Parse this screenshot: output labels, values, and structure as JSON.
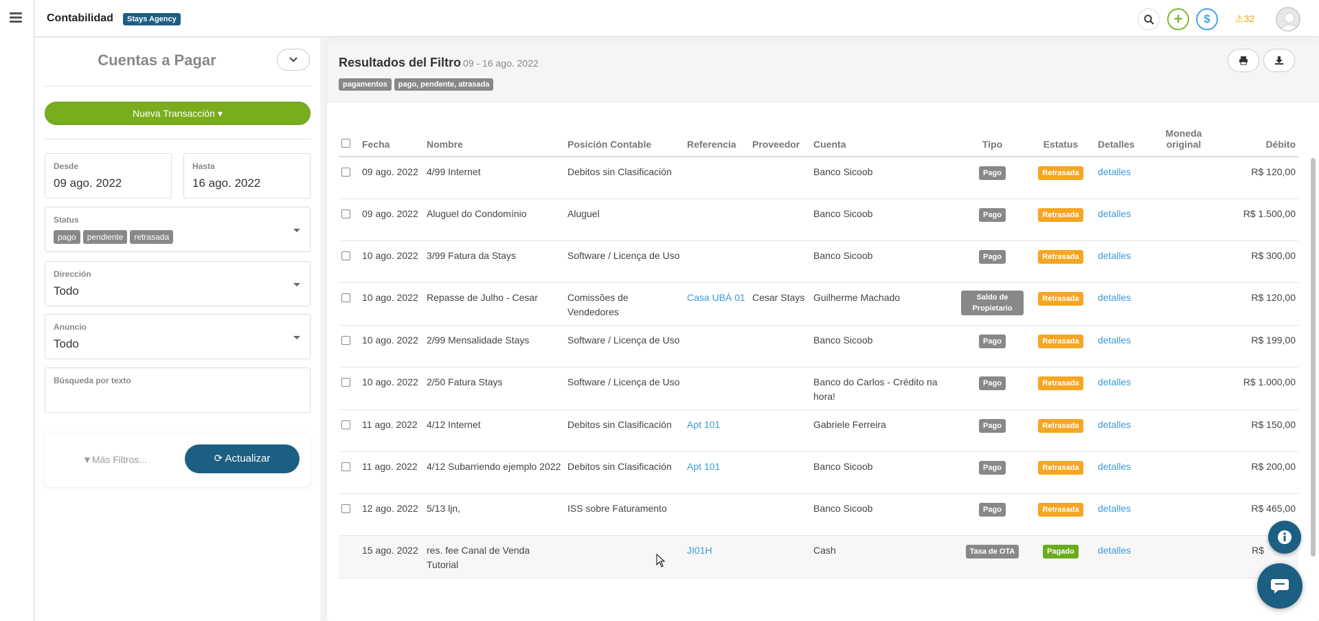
{
  "app": {
    "title": "Contabilidad",
    "agency": "Stays Agency",
    "alerts": "32"
  },
  "colors": {
    "primary": "#1c5f83",
    "green": "#7aad1e",
    "late": "#f5a623",
    "paid": "#6aac1e",
    "link": "#3a9ad9"
  },
  "left": {
    "title": "Cuentas a Pagar",
    "new_transaction": "Nueva Transacción",
    "desde_label": "Desde",
    "desde_value": "09 ago. 2022",
    "hasta_label": "Hasta",
    "hasta_value": "16 ago. 2022",
    "status_label": "Status",
    "status_tags": [
      "pago",
      "pendiente",
      "retrasada"
    ],
    "direccion_label": "Dirección",
    "direccion_value": "Todo",
    "anuncio_label": "Anuncio",
    "anuncio_value": "Todo",
    "search_label": "Búsqueda por texto",
    "more_filters": "Más Filtros...",
    "refresh": "Actualizar"
  },
  "main": {
    "title": "Resultados del Filtro",
    "range": "09 - 16 ago. 2022",
    "tags": [
      "pagamentos",
      "pago, pendente, atrasada"
    ],
    "columns": [
      "Fecha",
      "Nombre",
      "Posición Contable",
      "Referencia",
      "Proveedor",
      "Cuenta",
      "Tipo",
      "Estatus",
      "Detalles",
      "Moneda original",
      "Débito"
    ],
    "rows": [
      {
        "fecha": "09 ago. 2022",
        "nombre": "4/99  Internet",
        "posicion": "Debitos sin Clasificación",
        "referencia": "",
        "proveedor": "",
        "cuenta": "Banco Sicoob",
        "tipo": "Pago",
        "estatus": "Retrasada",
        "detalles": "detalles",
        "moneda": "",
        "debito": "R$ 120,00"
      },
      {
        "fecha": "09 ago. 2022",
        "nombre": "Aluguel do Condomínio",
        "posicion": "Aluguel",
        "referencia": "",
        "proveedor": "",
        "cuenta": "Banco Sicoob",
        "tipo": "Pago",
        "estatus": "Retrasada",
        "detalles": "detalles",
        "moneda": "",
        "debito": "R$ 1.500,00"
      },
      {
        "fecha": "10 ago. 2022",
        "nombre": "3/99  Fatura da Stays",
        "posicion": "Software / Licença de Uso",
        "referencia": "",
        "proveedor": "",
        "cuenta": "Banco Sicoob",
        "tipo": "Pago",
        "estatus": "Retrasada",
        "detalles": "detalles",
        "moneda": "",
        "debito": "R$ 300,00"
      },
      {
        "fecha": "10 ago. 2022",
        "nombre": "Repasse de Julho - Cesar",
        "posicion": "Comissões de Vendedores",
        "referencia": "Casa UBÁ 01",
        "proveedor": "Cesar Stays",
        "cuenta": "Guilherme Machado",
        "tipo": "Saldo de Propietario",
        "estatus": "Retrasada",
        "detalles": "detalles",
        "moneda": "",
        "debito": "R$ 120,00"
      },
      {
        "fecha": "10 ago. 2022",
        "nombre": "2/99  Mensalidade Stays",
        "posicion": "Software / Licença de Uso",
        "referencia": "",
        "proveedor": "",
        "cuenta": "Banco Sicoob",
        "tipo": "Pago",
        "estatus": "Retrasada",
        "detalles": "detalles",
        "moneda": "",
        "debito": "R$ 199,00"
      },
      {
        "fecha": "10 ago. 2022",
        "nombre": "2/50  Fatura Stays",
        "posicion": "Software / Licença de Uso",
        "referencia": "",
        "proveedor": "",
        "cuenta": "Banco do Carlos - Crédito na hora!",
        "tipo": "Pago",
        "estatus": "Retrasada",
        "detalles": "detalles",
        "moneda": "",
        "debito": "R$ 1.000,00"
      },
      {
        "fecha": "11 ago. 2022",
        "nombre": "4/12  Internet",
        "posicion": "Debitos sin Clasificación",
        "referencia": "Apt 101",
        "proveedor": "",
        "cuenta": "Gabriele Ferreira",
        "tipo": "Pago",
        "estatus": "Retrasada",
        "detalles": "detalles",
        "moneda": "",
        "debito": "R$ 150,00"
      },
      {
        "fecha": "11 ago. 2022",
        "nombre": "4/12  Subarriendo ejemplo 2022",
        "posicion": "Debitos sin Clasificación",
        "referencia": "Apt 101",
        "proveedor": "",
        "cuenta": "Banco Sicoob",
        "tipo": "Pago",
        "estatus": "Retrasada",
        "detalles": "detalles",
        "moneda": "",
        "debito": "R$ 200,00"
      },
      {
        "fecha": "12 ago. 2022",
        "nombre": "5/13  ljn,",
        "posicion": "ISS sobre Faturamento",
        "referencia": "",
        "proveedor": "",
        "cuenta": "Banco Sicoob",
        "tipo": "Pago",
        "estatus": "Retrasada",
        "detalles": "detalles",
        "moneda": "",
        "debito": "R$ 465,00"
      },
      {
        "fecha": "15 ago. 2022",
        "nombre": "res. fee Canal de Venda Tutorial",
        "posicion": "",
        "referencia": "JI01H",
        "proveedor": "",
        "cuenta": "Cash",
        "tipo": "Tasa de OTA",
        "estatus": "Pagado",
        "detalles": "detalles",
        "moneda": "",
        "debito": "R$"
      }
    ]
  }
}
